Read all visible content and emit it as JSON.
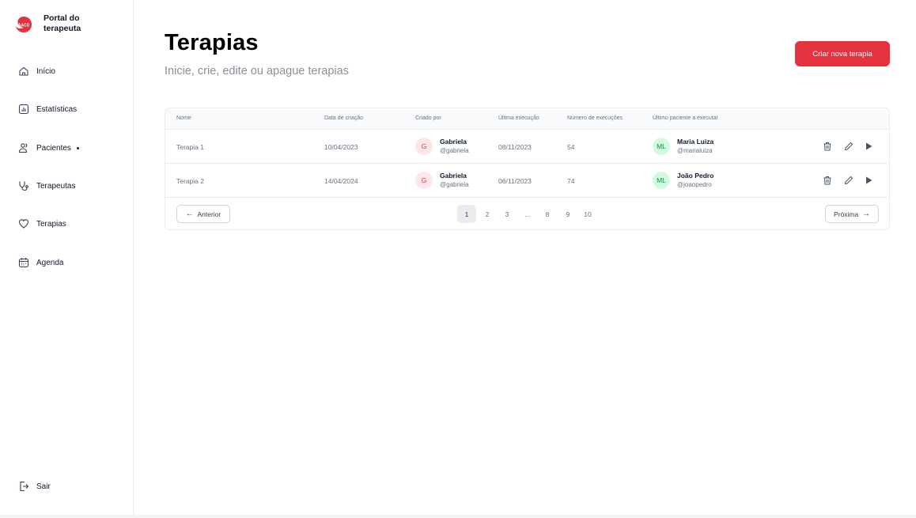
{
  "app": {
    "brand_title": "Portal do terapeuta",
    "logo_text": "AACD",
    "accent_color": "#e4323f"
  },
  "sidebar": {
    "items": [
      {
        "label": "Início",
        "icon": "home-icon"
      },
      {
        "label": "Estatísticas",
        "icon": "chart-icon"
      },
      {
        "label": "Pacientes",
        "icon": "users-icon"
      },
      {
        "label": "Terapeutas",
        "icon": "stethoscope-icon"
      },
      {
        "label": "Terapias",
        "icon": "heart-icon"
      },
      {
        "label": "Agenda",
        "icon": "calendar-icon"
      }
    ],
    "logout_label": "Sair"
  },
  "header": {
    "title": "Terapias",
    "subtitle": "Inicie, crie, edite ou apague terapias",
    "create_button": "Criar nova terapia"
  },
  "table": {
    "columns": [
      "Nome",
      "Data de criação",
      "Criado por",
      "Última execução",
      "Número de execuções",
      "Último paciente a executar"
    ],
    "rows": [
      {
        "name": "Terapia 1",
        "created": "10/04/2023",
        "creator_initial": "G",
        "creator_name": "Gabriela",
        "creator_handle": "@gabriela",
        "last_run": "08/11/2023",
        "runs": "54",
        "patient_initials": "ML",
        "patient_name": "Maria Luiza",
        "patient_handle": "@marialuiza"
      },
      {
        "name": "Terapia 2",
        "created": "14/04/2024",
        "creator_initial": "G",
        "creator_name": "Gabriela",
        "creator_handle": "@gabriela",
        "last_run": "06/11/2023",
        "runs": "74",
        "patient_initials": "ML",
        "patient_name": "João Pedro",
        "patient_handle": "@joaopedro"
      }
    ]
  },
  "pagination": {
    "prev_label": "Anterior",
    "next_label": "Próxima",
    "pages": [
      "1",
      "2",
      "3",
      "...",
      "8",
      "9",
      "10"
    ],
    "current": "1"
  }
}
